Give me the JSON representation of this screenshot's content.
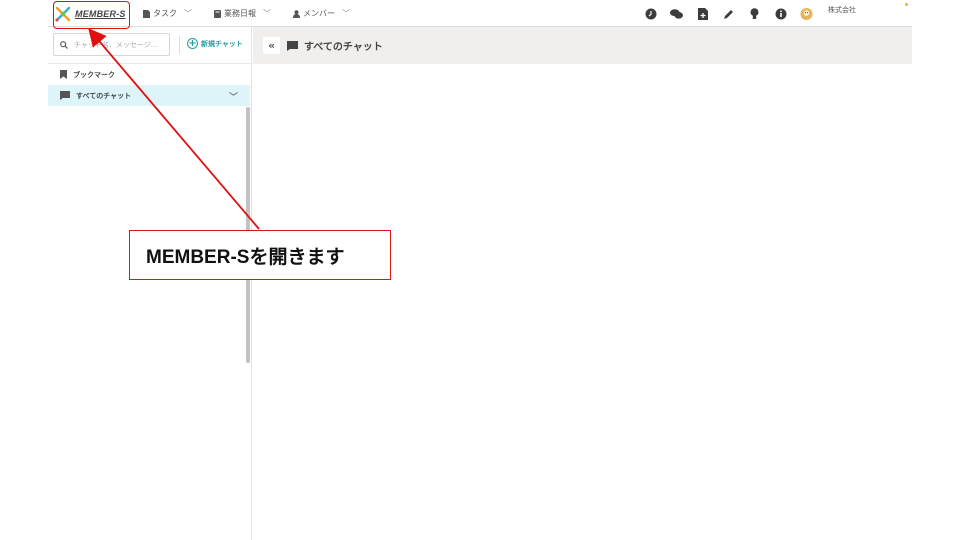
{
  "header": {
    "logo_text": "MEMBER-S",
    "nav": [
      {
        "label": "タスク",
        "icon": "document-icon"
      },
      {
        "label": "業務日報",
        "icon": "book-icon"
      },
      {
        "label": "メンバー",
        "icon": "person-icon"
      }
    ],
    "company": "株式会社"
  },
  "sidebar": {
    "search_placeholder": "チャット名、メッセージ...",
    "new_chat_label": "新規チャット",
    "items": [
      {
        "label": "ブックマーク",
        "icon": "bookmark-icon"
      },
      {
        "label": "すべてのチャット",
        "icon": "chat-bubble-icon"
      }
    ]
  },
  "main": {
    "title": "すべてのチャット"
  },
  "annotation": {
    "text": "MEMBER-Sを開きます"
  },
  "colors": {
    "accent": "#2a9d9d",
    "annotation_red": "#d71818",
    "active_row": "#ddf4f8",
    "main_header_bg": "#f1efed"
  }
}
